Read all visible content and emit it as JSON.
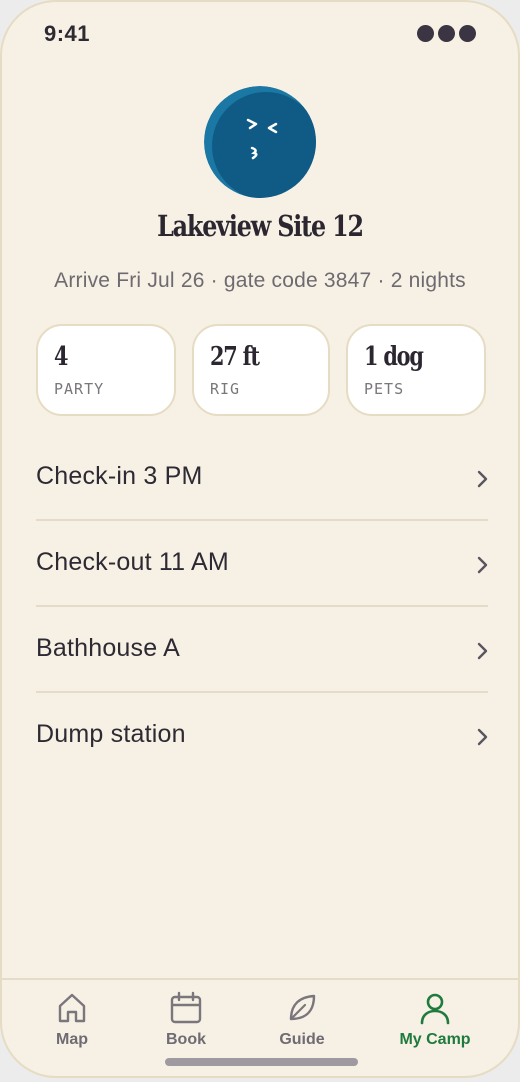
{
  "status_bar": {
    "time": "9:41"
  },
  "profile": {
    "site_name": "Lakeview Site 12",
    "subtitle": "Arrive Fri Jul 26 · gate code 3847 · 2 nights",
    "avatar_color": "#0f5b85"
  },
  "stats": [
    {
      "value": "4",
      "label": "PARTY"
    },
    {
      "value": "27 ft",
      "label": "RIG"
    },
    {
      "value": "1 dog",
      "label": "PETS"
    }
  ],
  "list": [
    {
      "label": "Check-in 3 PM"
    },
    {
      "label": "Check-out 11 AM"
    },
    {
      "label": "Bathhouse A"
    },
    {
      "label": "Dump station"
    }
  ],
  "tabs": [
    {
      "label": "Map",
      "icon": "home-icon",
      "active": false
    },
    {
      "label": "Book",
      "icon": "calendar-icon",
      "active": false
    },
    {
      "label": "Guide",
      "icon": "leaf-icon",
      "active": false
    },
    {
      "label": "My Camp",
      "icon": "person-icon",
      "active": true
    }
  ],
  "colors": {
    "background": "#f7f0e4",
    "accent": "#1f7a3d",
    "avatar": "#0f5b85"
  }
}
